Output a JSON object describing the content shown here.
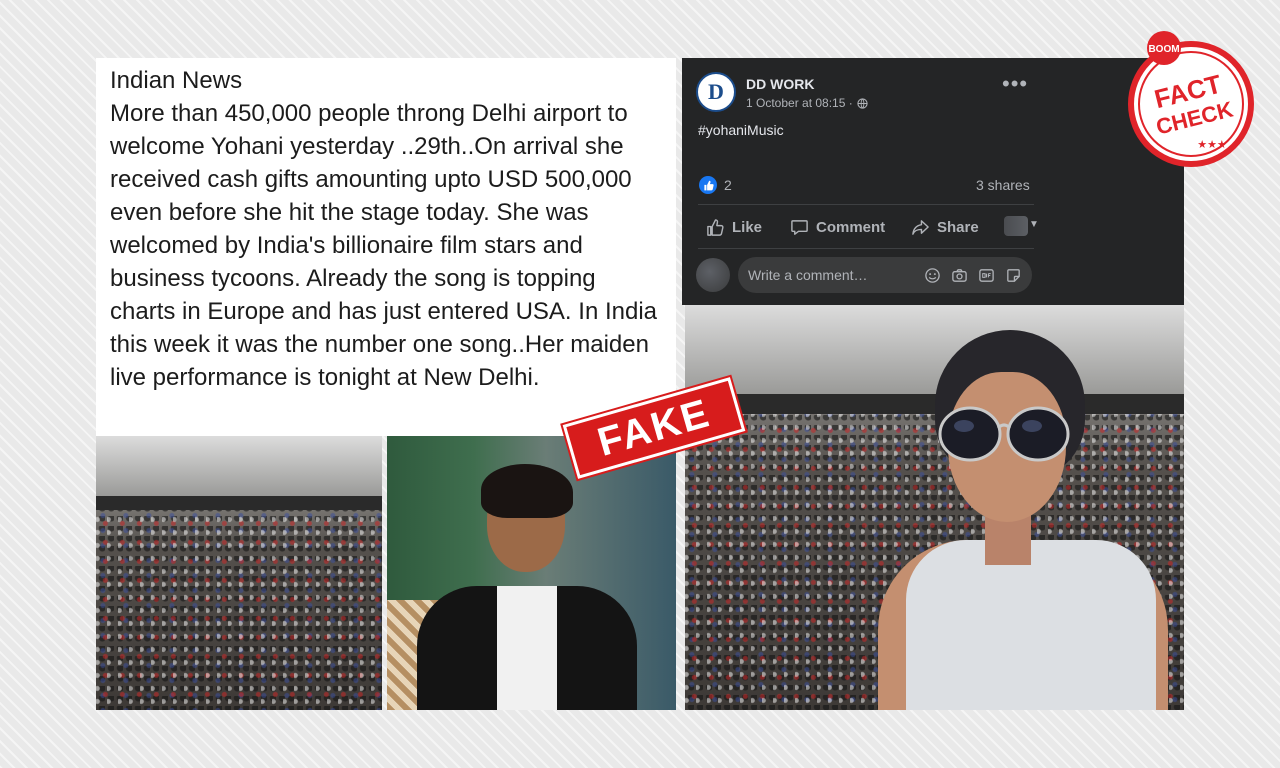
{
  "left_post": {
    "source": "Indian News",
    "body": "More than 450,000 people throng Delhi airport to welcome Yohani yesterday ..29th..On arrival she received  cash gifts amounting upto USD 500,000 even before she hit the stage today. She was welcomed by India's billionaire film stars and business tycoons.  Already the song is topping charts in Europe and has just entered USA. In India this week it was the number one song..Her maiden live performance is tonight at New Delhi."
  },
  "fb_post": {
    "page_name": "DD WORK",
    "avatar_letter": "D",
    "timestamp": "1 October at 08:15 ·",
    "more_icon": "more-options-icon",
    "hashtag": "#yohaniMusic",
    "reaction_count": "2",
    "shares": "3 shares",
    "actions": {
      "like": "Like",
      "comment": "Comment",
      "share": "Share"
    },
    "comment_placeholder": "Write a comment…"
  },
  "stamps": {
    "fake": "FAKE",
    "boom": "BOOM",
    "fact": "FACT",
    "check": "CHECK"
  },
  "colors": {
    "fb_background": "#242526",
    "fb_like_blue": "#1877f2",
    "stamp_red": "#d71c1c"
  }
}
